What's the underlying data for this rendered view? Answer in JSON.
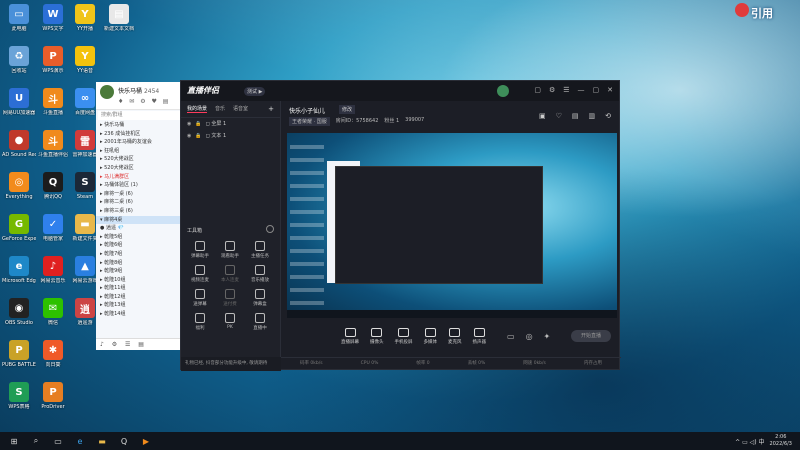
{
  "desktop_icons": [
    {
      "label": "此电脑",
      "color": "#4a90d9",
      "glyph": "▭"
    },
    {
      "label": "WPS文字",
      "color": "#2b6fd6",
      "glyph": "W"
    },
    {
      "label": "YY开播",
      "color": "#f0c419",
      "glyph": "Y"
    },
    {
      "label": "新建文本文档",
      "color": "#e8e8e8",
      "glyph": "▤"
    },
    {
      "label": "回收站",
      "color": "#6aa3d8",
      "glyph": "♻"
    },
    {
      "label": "WPS演示",
      "color": "#e85d2a",
      "glyph": "P"
    },
    {
      "label": "YY语音",
      "color": "#f4c20d",
      "glyph": "Y"
    },
    {
      "label": "网易UU加速器",
      "color": "#2c6ed5",
      "glyph": "U"
    },
    {
      "label": "斗鱼直播",
      "color": "#f08a1c",
      "glyph": "斗"
    },
    {
      "label": "百度网盘",
      "color": "#3b8ff0",
      "glyph": "∞"
    },
    {
      "label": "AD Sound Recorder",
      "color": "#c0392b",
      "glyph": "●"
    },
    {
      "label": "斗鱼直播伴侣",
      "color": "#f08a1c",
      "glyph": "斗"
    },
    {
      "label": "雷神加速器",
      "color": "#d13b3b",
      "glyph": "雷"
    },
    {
      "label": "Everything",
      "color": "#f28b1c",
      "glyph": "◎"
    },
    {
      "label": "腾讯QQ",
      "color": "#1c1c1c",
      "glyph": "Q"
    },
    {
      "label": "Steam",
      "color": "#1b2838",
      "glyph": "S"
    },
    {
      "label": "GeForce Experience",
      "color": "#76b900",
      "glyph": "G"
    },
    {
      "label": "电脑管家",
      "color": "#2f80ed",
      "glyph": "✓"
    },
    {
      "label": "新建文件夹",
      "color": "#e8b84a",
      "glyph": "▬"
    },
    {
      "label": "Microsoft Edge",
      "color": "#1e88c8",
      "glyph": "e"
    },
    {
      "label": "网易云音乐",
      "color": "#e02020",
      "glyph": "♪"
    },
    {
      "label": "网易云游戏",
      "color": "#2a7fe0",
      "glyph": "▲"
    },
    {
      "label": "OBS Studio",
      "color": "#222",
      "glyph": "◉"
    },
    {
      "label": "微信",
      "color": "#2dc100",
      "glyph": "✉"
    },
    {
      "label": "逍遥游",
      "color": "#c44",
      "glyph": "逍"
    },
    {
      "label": "PUBG BATTLEGR...",
      "color": "#c9a227",
      "glyph": "P"
    },
    {
      "label": "向日葵",
      "color": "#f05a28",
      "glyph": "✱"
    },
    {
      "label": "WPS表格",
      "color": "#1f9d55",
      "glyph": "S"
    },
    {
      "label": "ProDriver",
      "color": "#e67e22",
      "glyph": "P"
    }
  ],
  "qq_panel": {
    "user_name": "快乐马桶",
    "number": "2454",
    "icons": "♦ ✉ ⚙ ♥ ▤",
    "search_placeholder": "搜索/群组",
    "rows": [
      {
        "text": "▸ 快乐马桶",
        "sel": false,
        "red": false
      },
      {
        "text": "▸ 236 成仙挂机区",
        "sel": false,
        "red": false
      },
      {
        "text": "▸ 2001年马桶的友谊会",
        "sel": false,
        "red": false
      },
      {
        "text": "▸ 狂吼组",
        "sel": false,
        "red": false
      },
      {
        "text": "▸ 520大佬战区",
        "sel": false,
        "red": false
      },
      {
        "text": "▸ 520大佬战区",
        "sel": false,
        "red": false
      },
      {
        "text": "▸ 马儿满群区",
        "sel": false,
        "red": true
      },
      {
        "text": "▸ 马桶体验区 (1)",
        "sel": false,
        "red": false
      },
      {
        "text": "▸ 麻将一桌 (6)",
        "sel": false,
        "red": false
      },
      {
        "text": "▸ 麻将二桌 (6)",
        "sel": false,
        "red": false
      },
      {
        "text": "▸ 麻将三桌 (6)",
        "sel": false,
        "red": false
      },
      {
        "text": "▾ 麻将4桌",
        "sel": true,
        "red": false
      },
      {
        "text": "    ● 逍遥 💎",
        "sel": false,
        "red": false
      },
      {
        "text": "▸ 乾隆5组",
        "sel": false,
        "red": false
      },
      {
        "text": "▸ 乾隆6组",
        "sel": false,
        "red": false
      },
      {
        "text": "▸ 乾隆7组",
        "sel": false,
        "red": false
      },
      {
        "text": "▸ 乾隆8组",
        "sel": false,
        "red": false
      },
      {
        "text": "▸ 乾隆9组",
        "sel": false,
        "red": false
      },
      {
        "text": "▸ 乾隆10组",
        "sel": false,
        "red": false
      },
      {
        "text": "▸ 乾隆11组",
        "sel": false,
        "red": false
      },
      {
        "text": "▸ 乾隆12组",
        "sel": false,
        "red": false
      },
      {
        "text": "▸ 乾隆13组",
        "sel": false,
        "red": false
      },
      {
        "text": "▸ 乾隆14组",
        "sel": false,
        "red": false
      }
    ],
    "footer_icons": "♪ ⚙ ☰ ▤"
  },
  "app": {
    "logo": "直播伴侣",
    "badge": "测试 ▶",
    "window_controls": [
      "▢",
      "⚙",
      "☰",
      "—",
      "▢",
      "✕"
    ],
    "tabs": [
      "我的场景",
      "音乐",
      "语音室"
    ],
    "active_tab": 0,
    "layers": [
      {
        "label": "◻ 全屏 1"
      },
      {
        "label": "◻ 文本 1"
      }
    ],
    "tools_title": "工具箱",
    "tools": [
      {
        "label": "弹幕助手",
        "dim": false
      },
      {
        "label": "观看助手",
        "dim": false
      },
      {
        "label": "主播任务",
        "dim": false
      },
      {
        "label": "视频连麦",
        "dim": false
      },
      {
        "label": "本人连麦",
        "dim": true
      },
      {
        "label": "音乐播放",
        "dim": false
      },
      {
        "label": "送弹幕",
        "dim": false
      },
      {
        "label": "送付费",
        "dim": true
      },
      {
        "label": "弹幕盒",
        "dim": false
      },
      {
        "label": "福利",
        "dim": false
      },
      {
        "label": "PK",
        "dim": false
      },
      {
        "label": "直播中",
        "dim": false
      }
    ],
    "notice": "礼物已经, 抖音部分功能升级中, 敬请期待",
    "room": {
      "name": "快乐小子仙儿",
      "edit_label": "修改",
      "meta": [
        "王者荣耀 · 国服",
        "房间ID：5758642",
        "粉丝 1",
        "399007"
      ]
    },
    "room_icons": [
      "▣",
      "♡",
      "▤",
      "▥",
      "⟲"
    ],
    "bottom_tools": [
      "直播屏幕",
      "摄像头",
      "手机投屏",
      "多媒体",
      "麦克风",
      "扬声器"
    ],
    "bottom_icons": [
      "▭",
      "◎",
      "✦"
    ],
    "start_label": "开始直播",
    "status": [
      "码率 0kb/s",
      "CPU 0%",
      "帧率 0",
      "丢帧 0%",
      "网速 0kb/s",
      "内存占用"
    ]
  },
  "taskbar": {
    "time": "2:06",
    "date": "2022/6/3",
    "tray": "^ ▭ ◁) 中"
  }
}
